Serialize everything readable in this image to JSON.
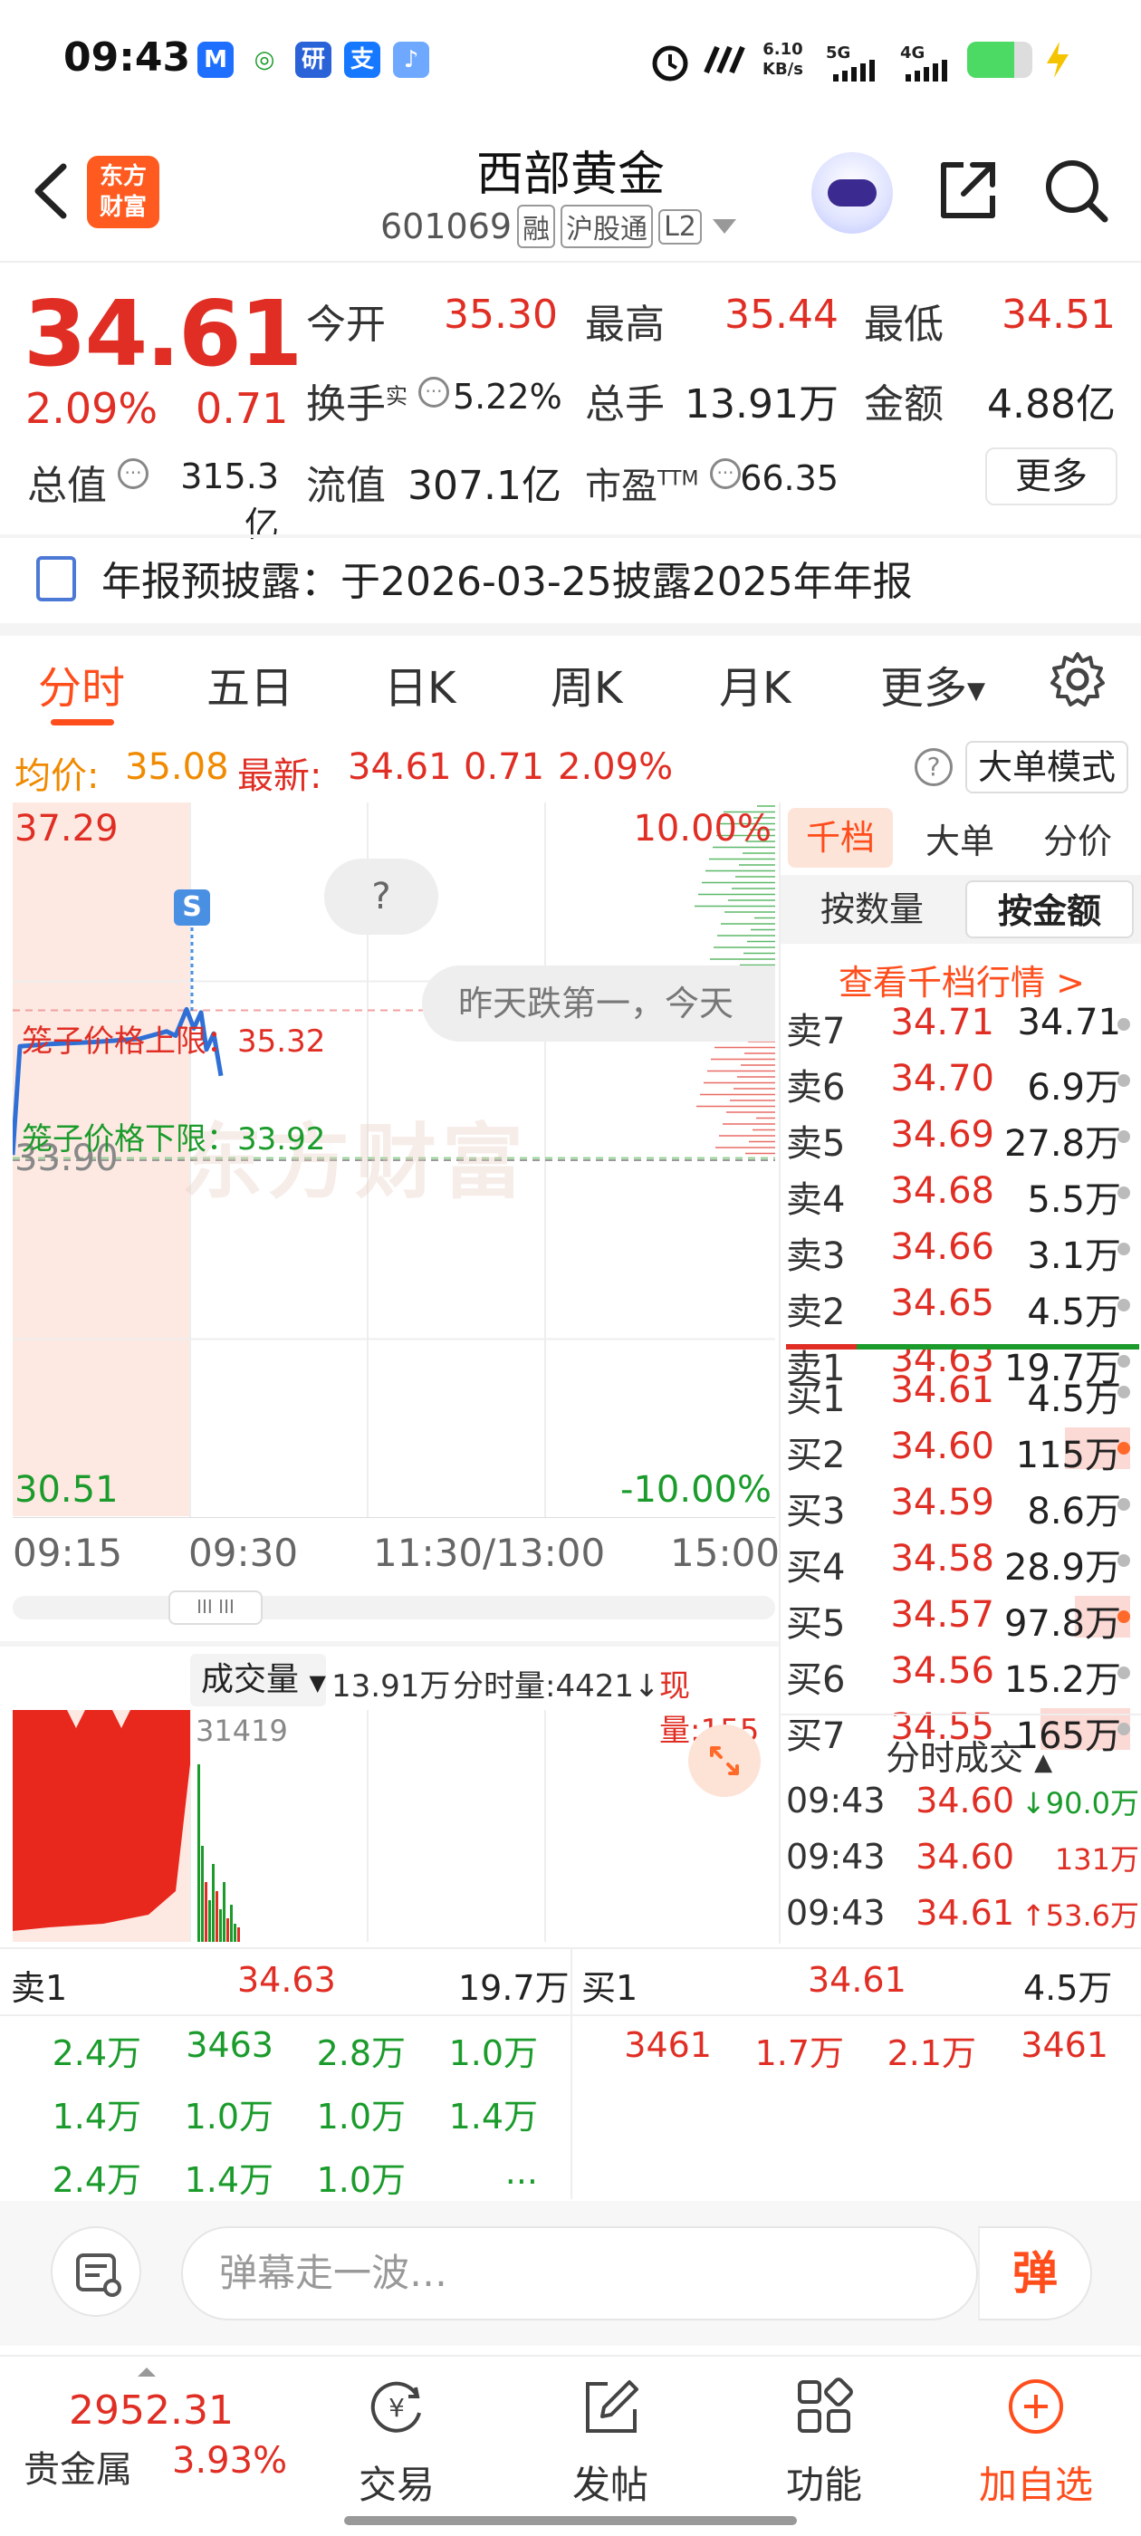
{
  "status_bar": {
    "time": "09:43",
    "apps": [
      "M",
      "◎",
      "研",
      "支",
      "♪"
    ],
    "net_speed_value": "6.10",
    "net_speed_unit": "KB/s",
    "signal_1": "5G",
    "signal_2": "4G",
    "battery_level": 0.72
  },
  "header": {
    "logo_line1": "东方",
    "logo_line2": "财富",
    "stock_name": "西部黄金",
    "stock_code": "601069",
    "tags": [
      "融",
      "沪股通",
      "L2"
    ]
  },
  "quote": {
    "price": "34.61",
    "change_pct": "2.09%",
    "change_amt": "0.71",
    "stats": [
      {
        "label": "今开",
        "value": "35.30"
      },
      {
        "label": "最高",
        "value": "35.44"
      },
      {
        "label": "最低",
        "value": "34.51"
      },
      {
        "label": "换手",
        "sup": "实",
        "value": "5.22%"
      },
      {
        "label": "总手",
        "value": "13.91万"
      },
      {
        "label": "金额",
        "value": "4.88亿"
      },
      {
        "label": "总值",
        "value": "315.3亿"
      },
      {
        "label": "流值",
        "value": "307.1亿"
      },
      {
        "label": "市盈",
        "sup": "TTM",
        "value": "66.35"
      }
    ],
    "more": "更多"
  },
  "notice": {
    "text": "年报预披露：于2026-03-25披露2025年年报"
  },
  "tabs": [
    "分时",
    "五日",
    "日K",
    "周K",
    "月K",
    "更多"
  ],
  "avg_bar": {
    "avg_label": "均价:",
    "avg_value": "35.08",
    "latest_label": "最新:",
    "latest_value": "34.61",
    "change_amt": "0.71",
    "change_pct": "2.09%",
    "help": "?",
    "big_order_mode": "大单模式"
  },
  "chart": {
    "y_top": "37.29",
    "y_mid": "33.90",
    "y_bottom": "30.51",
    "pct_top": "10.00%",
    "pct_bottom": "-10.00%",
    "x_ticks": [
      "09:15",
      "09:30",
      "11:30/13:00",
      "15:00"
    ],
    "bubble_question": "?",
    "bubble_message": "昨天跌第一，今天",
    "marker": "S",
    "cage_upper": "笼子价格上限：35.32",
    "cage_lower": "笼子价格下限：33.92",
    "watermark": "东方财富",
    "scroll_thumb": "III III",
    "price_line": [
      33.95,
      34.98,
      35.0,
      35.02,
      35.05,
      35.12,
      35.08,
      35.33,
      35.15,
      35.3,
      34.95,
      35.1,
      34.7
    ],
    "avg_line_y": 33.9
  },
  "volume": {
    "selector": "成交量",
    "total": "13.91万",
    "minute_vol": "分时量:4421↓",
    "current": "现量:155",
    "peak_label": "31419"
  },
  "order_book": {
    "tabs": [
      "千档",
      "大单",
      "分价"
    ],
    "sub_tabs": [
      "按数量",
      "按金额"
    ],
    "view_link": "查看千档行情 >",
    "asks": [
      {
        "label": "卖7",
        "price": "34.71",
        "vol": "34.71"
      },
      {
        "label": "卖6",
        "price": "34.70",
        "vol": "6.9万"
      },
      {
        "label": "卖5",
        "price": "34.69",
        "vol": "27.8万"
      },
      {
        "label": "卖4",
        "price": "34.68",
        "vol": "5.5万"
      },
      {
        "label": "卖3",
        "price": "34.66",
        "vol": "3.1万"
      },
      {
        "label": "卖2",
        "price": "34.65",
        "vol": "4.5万"
      },
      {
        "label": "卖1",
        "price": "34.63",
        "vol": "19.7万"
      }
    ],
    "bids": [
      {
        "label": "买1",
        "price": "34.61",
        "vol": "4.5万"
      },
      {
        "label": "买2",
        "price": "34.60",
        "vol": "115万"
      },
      {
        "label": "买3",
        "price": "34.59",
        "vol": "8.6万"
      },
      {
        "label": "买4",
        "price": "34.58",
        "vol": "28.9万"
      },
      {
        "label": "买5",
        "price": "34.57",
        "vol": "97.8万"
      },
      {
        "label": "买6",
        "price": "34.56",
        "vol": "15.2万"
      },
      {
        "label": "买7",
        "price": "34.55",
        "vol": "165万"
      }
    ],
    "trades_title": "分时成交",
    "trades": [
      {
        "time": "09:43",
        "price": "34.60",
        "vol": "↓90.0万"
      },
      {
        "time": "09:43",
        "price": "34.60",
        "vol": "131万"
      },
      {
        "time": "09:43",
        "price": "34.61",
        "vol": "↑53.6万"
      }
    ]
  },
  "level1": {
    "sell_label": "卖1",
    "sell_price": "34.63",
    "sell_vol": "19.7万",
    "buy_label": "买1",
    "buy_price": "34.61",
    "buy_vol": "4.5万",
    "sell_queue": [
      "2.4万",
      "3463",
      "2.8万",
      "1.0万",
      "1.4万",
      "1.0万",
      "1.0万",
      "1.4万",
      "2.4万",
      "1.4万",
      "1.0万",
      "..."
    ],
    "buy_queue": [
      "3461",
      "1.7万",
      "2.1万",
      "3461"
    ]
  },
  "comment": {
    "placeholder": "弹幕走一波…",
    "danmaku": "弹"
  },
  "bottom_nav": {
    "index_value": "2952.31",
    "index_name": "贵金属",
    "index_pct": "3.93%",
    "items": [
      "交易",
      "发帖",
      "功能",
      "加自选"
    ]
  }
}
